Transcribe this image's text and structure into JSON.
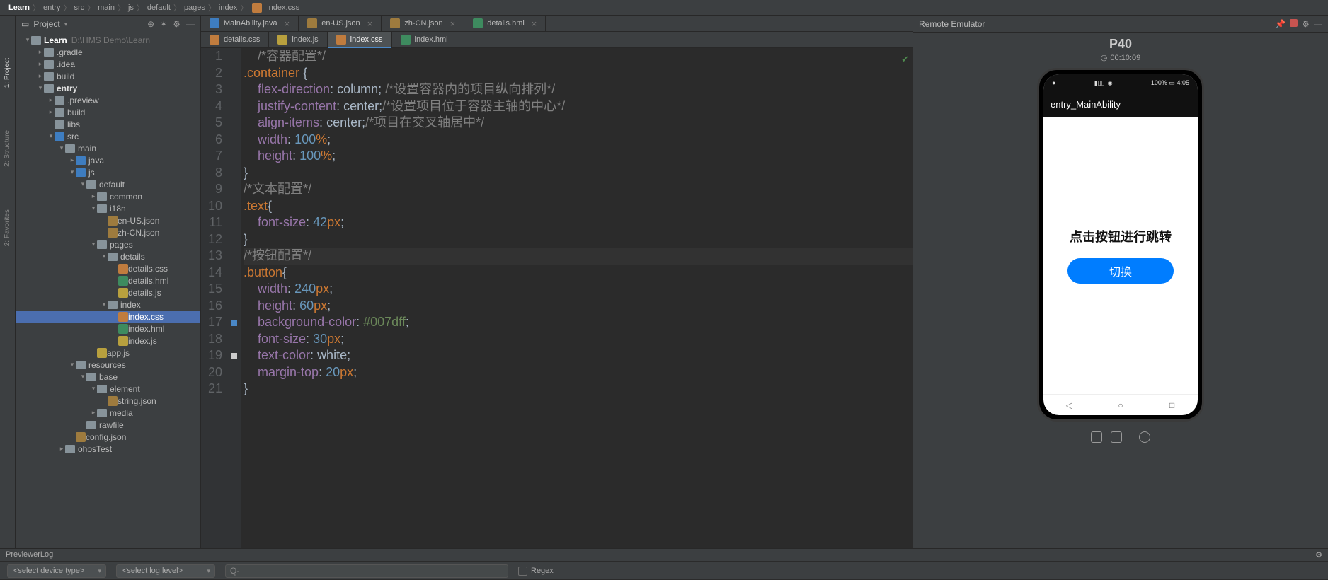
{
  "breadcrumb": [
    "Learn",
    "entry",
    "src",
    "main",
    "js",
    "default",
    "pages",
    "index"
  ],
  "breadcrumb_file": "index.css",
  "project": {
    "title": "Project",
    "root": "Learn",
    "root_path": "D:\\HMS Demo\\Learn",
    "tree": [
      {
        "label": ".gradle",
        "depth": 2,
        "arrow": "▸",
        "icon": "folder"
      },
      {
        "label": ".idea",
        "depth": 2,
        "arrow": "▸",
        "icon": "folder"
      },
      {
        "label": "build",
        "depth": 2,
        "arrow": "▸",
        "icon": "folder"
      },
      {
        "label": "entry",
        "depth": 2,
        "arrow": "▾",
        "icon": "folder",
        "bold": true
      },
      {
        "label": ".preview",
        "depth": 3,
        "arrow": "▸",
        "icon": "folder"
      },
      {
        "label": "build",
        "depth": 3,
        "arrow": "▸",
        "icon": "folder"
      },
      {
        "label": "libs",
        "depth": 3,
        "arrow": "",
        "icon": "folder"
      },
      {
        "label": "src",
        "depth": 3,
        "arrow": "▾",
        "icon": "folder-src"
      },
      {
        "label": "main",
        "depth": 4,
        "arrow": "▾",
        "icon": "folder"
      },
      {
        "label": "java",
        "depth": 5,
        "arrow": "▸",
        "icon": "folder-src"
      },
      {
        "label": "js",
        "depth": 5,
        "arrow": "▾",
        "icon": "folder-src"
      },
      {
        "label": "default",
        "depth": 6,
        "arrow": "▾",
        "icon": "folder"
      },
      {
        "label": "common",
        "depth": 7,
        "arrow": "▸",
        "icon": "folder"
      },
      {
        "label": "i18n",
        "depth": 7,
        "arrow": "▾",
        "icon": "folder"
      },
      {
        "label": "en-US.json",
        "depth": 8,
        "arrow": "",
        "icon": "json"
      },
      {
        "label": "zh-CN.json",
        "depth": 8,
        "arrow": "",
        "icon": "json"
      },
      {
        "label": "pages",
        "depth": 7,
        "arrow": "▾",
        "icon": "folder"
      },
      {
        "label": "details",
        "depth": 8,
        "arrow": "▾",
        "icon": "folder"
      },
      {
        "label": "details.css",
        "depth": 9,
        "arrow": "",
        "icon": "css"
      },
      {
        "label": "details.hml",
        "depth": 9,
        "arrow": "",
        "icon": "hml"
      },
      {
        "label": "details.js",
        "depth": 9,
        "arrow": "",
        "icon": "js"
      },
      {
        "label": "index",
        "depth": 8,
        "arrow": "▾",
        "icon": "folder"
      },
      {
        "label": "index.css",
        "depth": 9,
        "arrow": "",
        "icon": "css",
        "selected": true
      },
      {
        "label": "index.hml",
        "depth": 9,
        "arrow": "",
        "icon": "hml"
      },
      {
        "label": "index.js",
        "depth": 9,
        "arrow": "",
        "icon": "js"
      },
      {
        "label": "app.js",
        "depth": 7,
        "arrow": "",
        "icon": "js"
      },
      {
        "label": "resources",
        "depth": 5,
        "arrow": "▾",
        "icon": "folder"
      },
      {
        "label": "base",
        "depth": 6,
        "arrow": "▾",
        "icon": "folder"
      },
      {
        "label": "element",
        "depth": 7,
        "arrow": "▾",
        "icon": "folder"
      },
      {
        "label": "string.json",
        "depth": 8,
        "arrow": "",
        "icon": "json"
      },
      {
        "label": "media",
        "depth": 7,
        "arrow": "▸",
        "icon": "folder"
      },
      {
        "label": "rawfile",
        "depth": 6,
        "arrow": "",
        "icon": "folder"
      },
      {
        "label": "config.json",
        "depth": 5,
        "arrow": "",
        "icon": "json"
      },
      {
        "label": "ohosTest",
        "depth": 4,
        "arrow": "▸",
        "icon": "folder"
      }
    ]
  },
  "tabs_row1": [
    {
      "label": "MainAbility.java",
      "icon": "java"
    },
    {
      "label": "en-US.json",
      "icon": "json"
    },
    {
      "label": "zh-CN.json",
      "icon": "json"
    },
    {
      "label": "details.hml",
      "icon": "hml"
    }
  ],
  "tabs_row2": [
    {
      "label": "details.css",
      "icon": "css"
    },
    {
      "label": "index.js",
      "icon": "js"
    },
    {
      "label": "index.css",
      "icon": "css",
      "active": true,
      "underlined": true
    },
    {
      "label": "index.hml",
      "icon": "hml"
    }
  ],
  "code": {
    "lines": 21,
    "comments": {
      "l1": "/*容器配置*/",
      "l2a": "/*设置容器内的项目纵向排列*/",
      "l3a": "/*设置项目位于容器主轴的中心*/",
      "l4a": "/*项目在交叉轴居中*/",
      "l9": "/*文本配置*/",
      "l13": "/*按钮配置*/"
    },
    "container": {
      "selector": ".container",
      "flex_direction": "column",
      "justify_content": "center",
      "align_items": "center",
      "width": "100",
      "height": "100",
      "unit": "%"
    },
    "text": {
      "selector": ".text",
      "font_size": "42",
      "unit": "px"
    },
    "button": {
      "selector": ".button",
      "width": "240",
      "height": "60",
      "bg": "#007dff",
      "font_size": "30",
      "text_color": "white",
      "margin_top": "20",
      "unit": "px"
    }
  },
  "emulator": {
    "header": "Remote Emulator",
    "device": "P40",
    "elapsed": "00:10:09",
    "status_time": "4:05",
    "app_title": "entry_MainAbility",
    "screen_text": "点击按钮进行跳转",
    "screen_button": "切换"
  },
  "footer": {
    "previewer": "PreviewerLog",
    "combo1": "<select device type>",
    "combo2": "<select log level>",
    "search": "Q-",
    "regex": "Regex"
  },
  "side": {
    "project": "1: Project",
    "structure": "2: Structure",
    "favorites": "2: Favorites"
  }
}
